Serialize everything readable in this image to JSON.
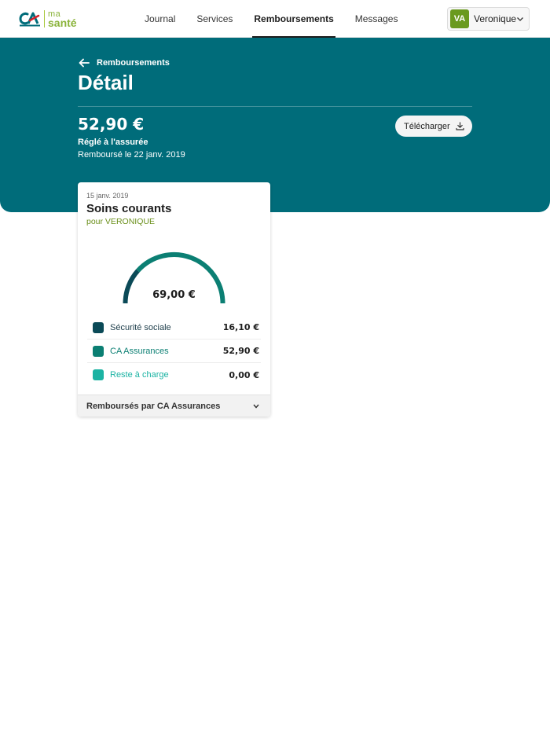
{
  "header": {
    "logo": {
      "brand": "CA",
      "ma": "ma",
      "sante": "santé",
      "icon": "credit-agricole-logo"
    },
    "nav": [
      {
        "label": "Journal",
        "active": false
      },
      {
        "label": "Services",
        "active": false
      },
      {
        "label": "Remboursements",
        "active": true
      },
      {
        "label": "Messages",
        "active": false
      }
    ],
    "user": {
      "initials": "VA",
      "name": "Veronique",
      "icon": "chevron-down-icon"
    }
  },
  "hero": {
    "back_label": "Remboursements",
    "back_icon": "arrow-left-icon",
    "title": "Détail",
    "amount": "52,90 €",
    "status": "Réglé à l'assurée",
    "reimbursed": "Remboursé le 22 janv. 2019",
    "download_label": "Télécharger",
    "download_icon": "download-icon"
  },
  "card": {
    "date": "15 janv. 2019",
    "title": "Soins courants",
    "for": "pour VERONIQUE",
    "total": "69,00 €",
    "breakdown": [
      {
        "label": "Sécurité sociale",
        "value": "16,10 €",
        "amount": 16.1,
        "color": "#0b4a57"
      },
      {
        "label": "CA Assurances",
        "value": "52,90 €",
        "amount": 52.9,
        "color": "#0b7f73"
      },
      {
        "label": "Reste à charge",
        "value": "0,00 €",
        "amount": 0.0,
        "color": "#1bb3a3"
      }
    ],
    "footer_label": "Remboursés par CA Assurances",
    "footer_icon": "chevron-down-icon"
  },
  "colors": {
    "hero_bg": "#006c7a",
    "brand_green": "#8ab33a",
    "avatar_bg": "#6a9a1f"
  }
}
